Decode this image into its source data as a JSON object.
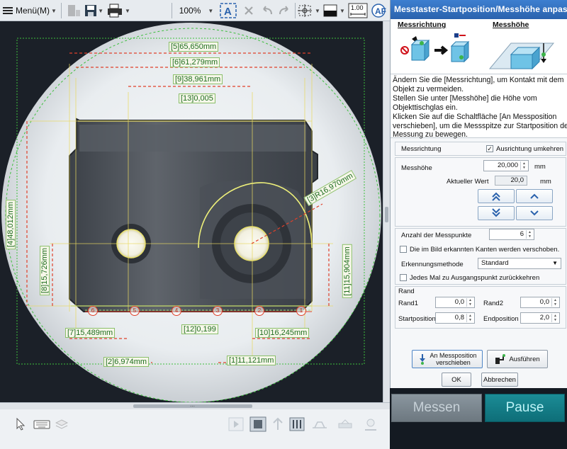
{
  "toolbar": {
    "menu_label": "Menü(M)",
    "zoom": "100%",
    "ratio_value": "1.00"
  },
  "viewport": {
    "dims": [
      {
        "label": "[5]65,650mm"
      },
      {
        "label": "[6]61,279mm"
      },
      {
        "label": "[9]38,961mm"
      },
      {
        "label": "[13]0,005"
      },
      {
        "label": "[3]R16,970mm"
      },
      {
        "label": "[4]48,012mm"
      },
      {
        "label": "[8]15,726mm"
      },
      {
        "label": "[11]15,904mm"
      },
      {
        "label": "[7]15,489mm"
      },
      {
        "label": "[12]0,199"
      },
      {
        "label": "[10]16,245mm"
      },
      {
        "label": "[2]6,974mm"
      },
      {
        "label": "[1]11,121mm"
      }
    ],
    "points": [
      "6",
      "5",
      "4",
      "3",
      "2",
      "1"
    ]
  },
  "panel": {
    "title": "Messtaster-Startposition/Messhöhe anpassen",
    "illus_direction": "Messrichtung",
    "illus_height": "Messhöhe",
    "description": [
      "Ändern Sie die [Messrichtung], um Kontakt mit dem",
      "Objekt zu vermeiden.",
      "Stellen Sie unter [Messhöhe] die Höhe vom",
      "Objekttischglas ein.",
      "Klicken Sie auf die Schaltfläche [An Messposition",
      "verschieben], um die Messspitze zur Startposition der",
      "Messung zu bewegen."
    ],
    "direction_label": "Messrichtung",
    "reverse_label": "Ausrichtung umkehren",
    "reverse_checked": true,
    "height_label": "Messhöhe",
    "height_value": "20,000",
    "height_unit": "mm",
    "current_label": "Aktueller Wert",
    "current_value": "20,0",
    "current_unit": "mm",
    "points_label": "Anzahl der Messpunkte",
    "points_value": "6",
    "shift_edges_label": "Die im Bild erkannten Kanten werden verschoben.",
    "detection_label": "Erkennungsmethode",
    "detection_value": "Standard",
    "return_label": "Jedes Mal zu Ausgangspunkt zurückkehren",
    "margin_title": "Rand",
    "rand1_label": "Rand1",
    "rand1_value": "0,0",
    "rand2_label": "Rand2",
    "rand2_value": "0,0",
    "start_label": "Startposition",
    "start_value": "0,8",
    "end_label": "Endposition",
    "end_value": "2,0",
    "move_button_line1": "An Messposition",
    "move_button_line2": "verschieben",
    "execute_button": "Ausführen",
    "ok_button": "OK",
    "cancel_button": "Abbrechen"
  },
  "actions": {
    "measure": "Messen",
    "pause": "Pause"
  },
  "colors": {
    "accent_blue": "#2a62ad",
    "dim_green": "#9be07a",
    "dim_red": "#e0402a",
    "guide_yellow": "#f0e060",
    "pause_teal": "#12808a"
  }
}
